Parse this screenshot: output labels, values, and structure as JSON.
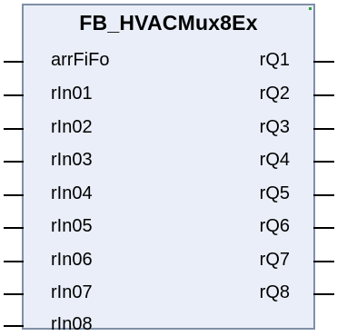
{
  "block": {
    "title": "FB_HVACMux8Ex",
    "inputs": [
      "arrFiFo",
      "rIn01",
      "rIn02",
      "rIn03",
      "rIn04",
      "rIn05",
      "rIn06",
      "rIn07",
      "rIn08"
    ],
    "outputs": [
      "rQ1",
      "rQ2",
      "rQ3",
      "rQ4",
      "rQ5",
      "rQ6",
      "rQ7",
      "rQ8"
    ]
  },
  "colors": {
    "block_fill": "#e9eef8",
    "block_border": "#7f8fa6",
    "accent": "#2ea043",
    "text": "#000000"
  }
}
